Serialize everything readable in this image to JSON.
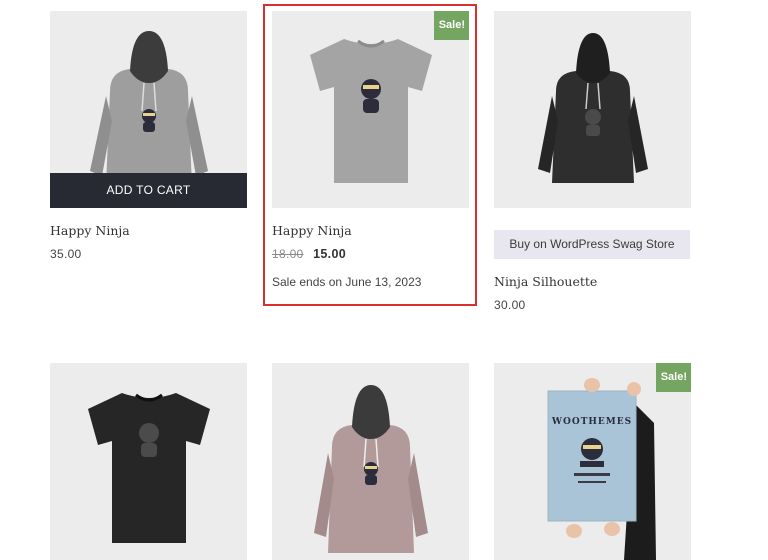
{
  "products": [
    {
      "title": "Happy Ninja",
      "price": "35.00",
      "hover_button": "ADD TO CART",
      "image": "gray-hoodie-ninja",
      "colors": {
        "garment": "#9e9e9e",
        "hood": "#3c3c3c"
      }
    },
    {
      "title": "Happy Ninja",
      "sale_badge": "Sale!",
      "price_old": "18.00",
      "price_new": "15.00",
      "sale_ends": "Sale ends on June 13, 2023",
      "image": "gray-tshirt-ninja",
      "colors": {
        "garment": "#a4a4a4"
      },
      "highlighted": true
    },
    {
      "title": "Ninja Silhouette",
      "price": "30.00",
      "external_button": "Buy on WordPress Swag Store",
      "image": "black-hoodie-ninja",
      "colors": {
        "garment": "#2e2e2e"
      }
    },
    {
      "image": "black-tshirt-ninja",
      "colors": {
        "garment": "#262626"
      }
    },
    {
      "image": "mauve-hoodie-ninja",
      "colors": {
        "garment": "#b29a9a",
        "hood": "#3b3b3b"
      }
    },
    {
      "sale_badge": "Sale!",
      "image": "woothemes-poster",
      "poster_text": "WOOTHEMES",
      "colors": {
        "poster": "#a9c4d6"
      }
    }
  ],
  "colors": {
    "sale_badge": "#74a561",
    "add_to_cart_bg": "#272a33",
    "highlight_border": "#d9302f",
    "external_button_bg": "#e8e6ee"
  }
}
